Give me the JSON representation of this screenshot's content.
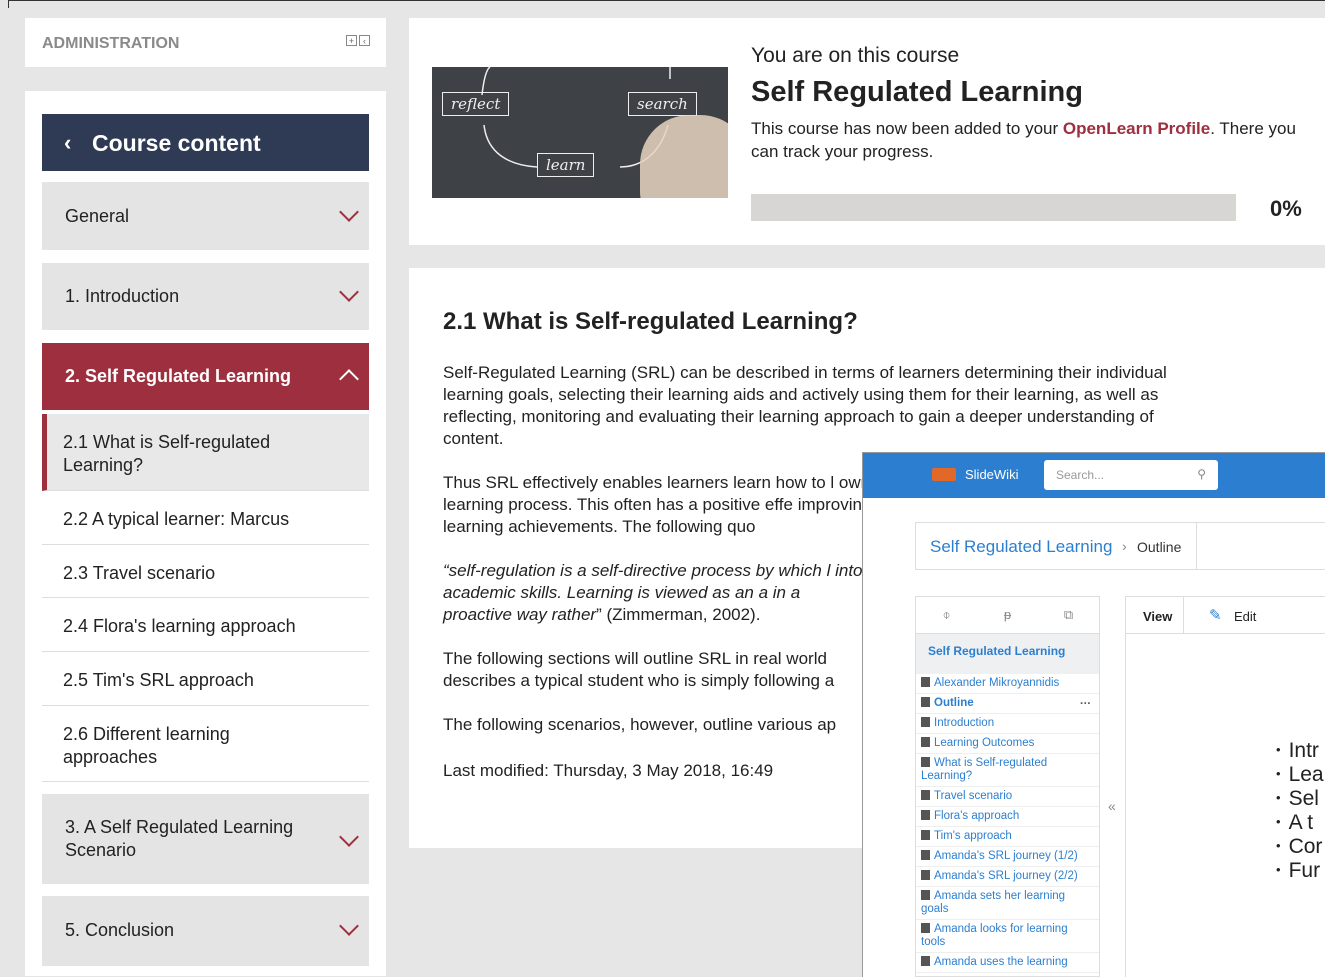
{
  "sidebar": {
    "admin_title": "ADMINISTRATION",
    "course_content_label": "Course content",
    "sections": [
      {
        "label": "General"
      },
      {
        "label": "1. Introduction"
      },
      {
        "label": "2. Self Regulated Learning"
      },
      {
        "label": "3. A Self Regulated Learning Scenario"
      },
      {
        "label": "5. Conclusion"
      }
    ],
    "subsections": [
      {
        "label": "2.1 What is Self-regulated Learning?"
      },
      {
        "label": "2.2 A typical learner: Marcus"
      },
      {
        "label": "2.3 Travel scenario"
      },
      {
        "label": "2.4 Flora's learning approach"
      },
      {
        "label": "2.5 Tim's SRL approach"
      },
      {
        "label": "2.6 Different learning approaches"
      }
    ]
  },
  "course": {
    "on_course_text": "You are on this course",
    "title": "Self Regulated Learning",
    "desc_before": "This course has now been added to your ",
    "profile_link": "OpenLearn Profile",
    "desc_after": ". There you can track your progress.",
    "progress_value": 0,
    "progress_label": "0%",
    "hero_words": [
      "reflect",
      "search",
      "learn"
    ]
  },
  "content": {
    "title": "2.1 What is Self-regulated Learning?",
    "p1": "Self-Regulated Learning (SRL) can be described in terms of learners determining their individual learning goals, selecting their learning aids and actively using them for their learning, as well as reflecting, monitoring and evaluating their learning approach to gain a deeper understanding of content.",
    "p2": "Thus SRL effectively enables learners learn how to l own learning process. This often has a positive effe improving learning achievements. The following quo",
    "quote_italic": "“self-regulation is a self-directive process by which l into academic skills. Learning is viewed as an a in a proactive way rather",
    "quote_cite": "” (Zimmerman, 2002).",
    "p4": "The following sections will outline SRL in real world describes a typical student who is simply following a",
    "p5": "The following scenarios, however, outline various ap",
    "last_modified": "Last modified: Thursday, 3 May 2018, 16:49"
  },
  "slidewiki": {
    "brand": "SlideWiki",
    "search_placeholder": "Search...",
    "breadcrumb_deck": "Self Regulated Learning",
    "breadcrumb_current": "Outline",
    "tab_view": "View",
    "tab_edit": "Edit",
    "tree_title": "Self Regulated Learning",
    "tree_items": [
      {
        "label": "Alexander Mikroyannidis"
      },
      {
        "label": "Outline"
      },
      {
        "label": "Introduction"
      },
      {
        "label": "Learning Outcomes"
      },
      {
        "label": "What is Self-regulated Learning?"
      },
      {
        "label": "Travel scenario"
      },
      {
        "label": "Flora's approach"
      },
      {
        "label": "Tim's approach"
      },
      {
        "label": "Amanda's SRL journey (1/2)"
      },
      {
        "label": "Amanda's SRL journey (2/2)"
      },
      {
        "label": "Amanda sets her learning goals"
      },
      {
        "label": "Amanda looks for learning tools"
      },
      {
        "label": "Amanda uses the learning"
      }
    ],
    "slide_bullets": [
      "Intr",
      "Lea",
      "Sel",
      "A t",
      "Cor",
      "Fur"
    ]
  }
}
